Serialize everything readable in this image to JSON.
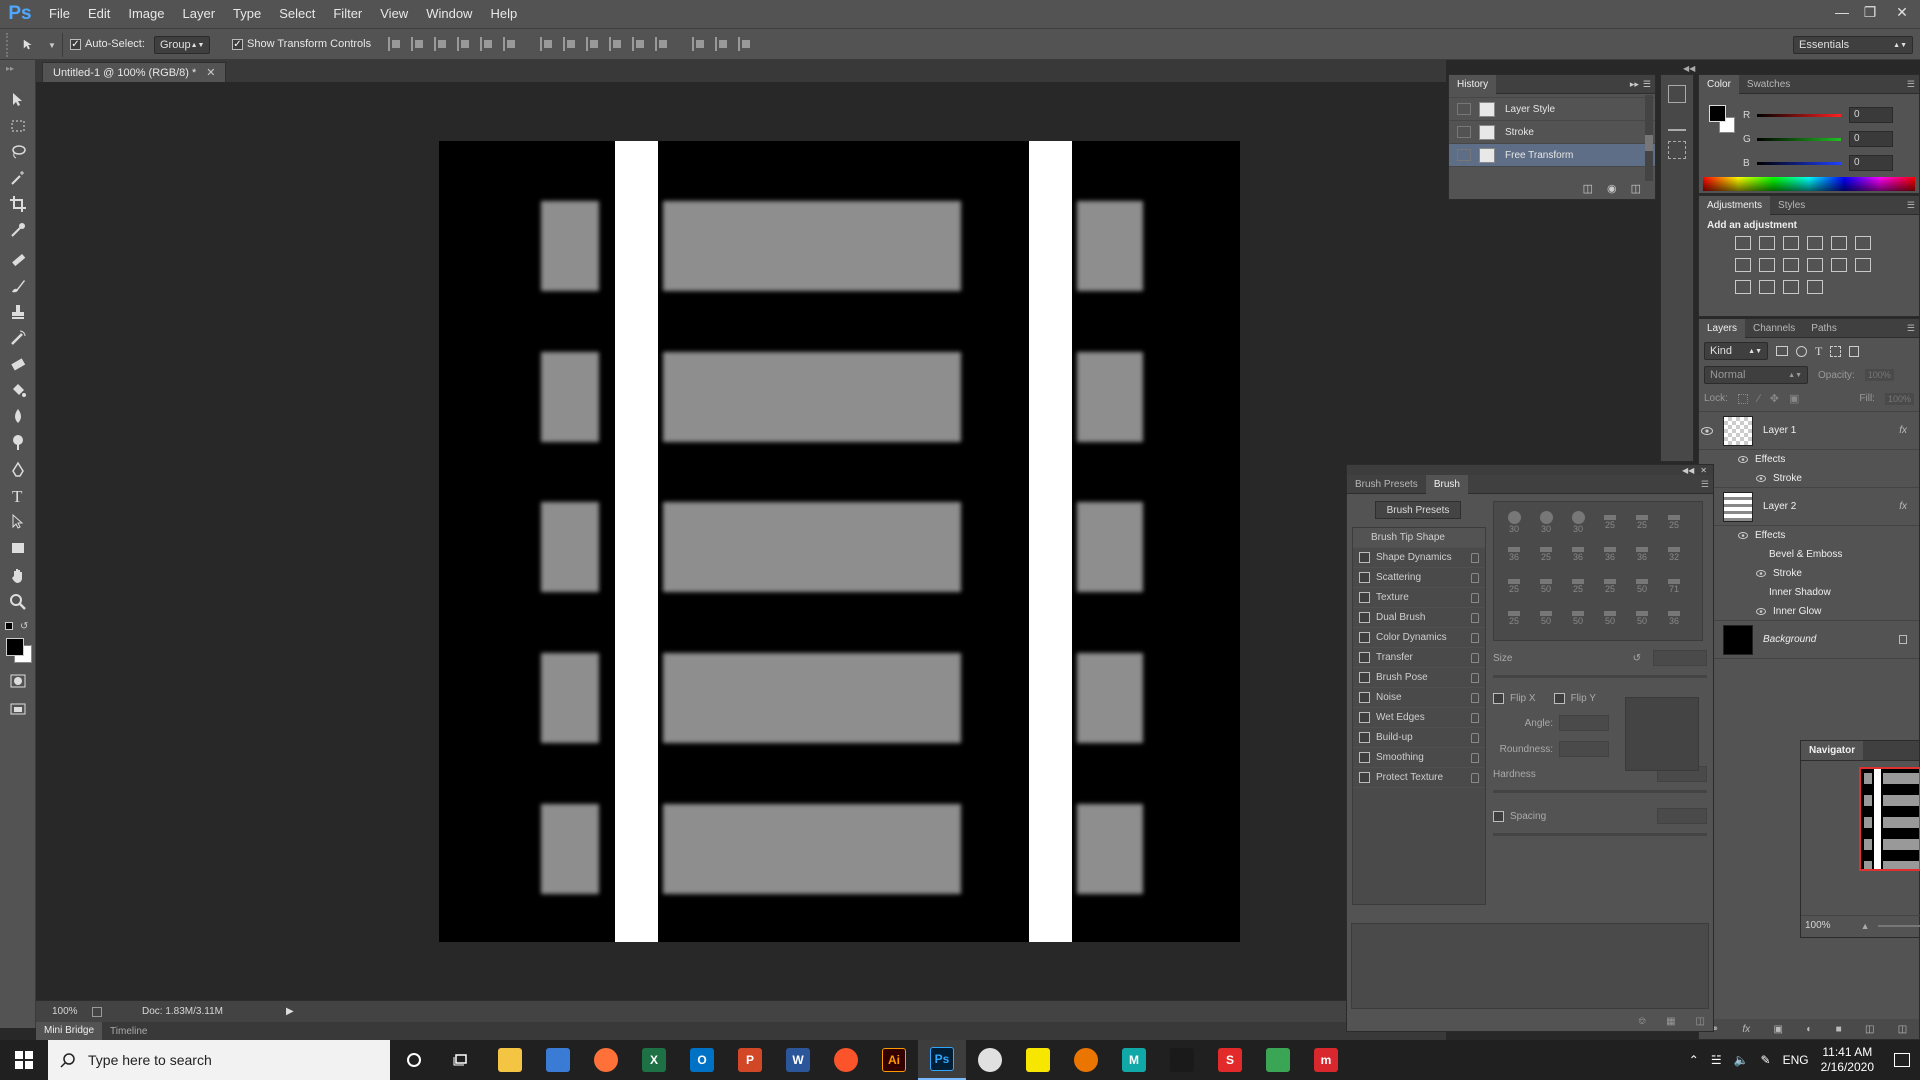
{
  "app": {
    "logo": "Ps"
  },
  "menu": [
    "File",
    "Edit",
    "Image",
    "Layer",
    "Type",
    "Select",
    "Filter",
    "View",
    "Window",
    "Help"
  ],
  "options": {
    "auto_select_label": "Auto-Select:",
    "auto_select_value": "Group",
    "transform_label": "Show Transform Controls",
    "workspace": "Essentials"
  },
  "document": {
    "tab_title": "Untitled-1 @ 100% (RGB/8) *",
    "zoom": "100%",
    "doc_info": "Doc: 1.83M/3.11M"
  },
  "bottom_tabs": [
    "Mini Bridge",
    "Timeline"
  ],
  "history": {
    "title": "History",
    "items": [
      {
        "label": "Layer Style"
      },
      {
        "label": "Stroke"
      },
      {
        "label": "Free Transform"
      }
    ]
  },
  "color_panel": {
    "tabs": [
      "Color",
      "Swatches"
    ],
    "channels": [
      {
        "name": "R",
        "value": "0",
        "color": "#ff2020"
      },
      {
        "name": "G",
        "value": "0",
        "color": "#20c020"
      },
      {
        "name": "B",
        "value": "0",
        "color": "#2040ff"
      }
    ]
  },
  "adjustments": {
    "tabs": [
      "Adjustments",
      "Styles"
    ],
    "heading": "Add an adjustment"
  },
  "layers": {
    "tabs": [
      "Layers",
      "Channels",
      "Paths"
    ],
    "kind": "Kind",
    "blend_mode": "Normal",
    "opacity_label": "Opacity:",
    "opacity_value": "100%",
    "lock_label": "Lock:",
    "fill_label": "Fill:",
    "fill_value": "100%",
    "layer1": {
      "name": "Layer 1",
      "effects": "Effects",
      "fx": [
        "Stroke"
      ]
    },
    "layer2": {
      "name": "Layer 2",
      "effects": "Effects",
      "fx": [
        "Bevel & Emboss",
        "Stroke",
        "Inner Shadow",
        "Inner Glow"
      ]
    },
    "background": {
      "name": "Background"
    }
  },
  "brush": {
    "tabs": [
      "Brush Presets",
      "Brush"
    ],
    "presets_button": "Brush Presets",
    "tip_shape": "Brush Tip Shape",
    "options": [
      "Shape Dynamics",
      "Scattering",
      "Texture",
      "Dual Brush",
      "Color Dynamics",
      "Transfer",
      "Brush Pose",
      "Noise",
      "Wet Edges",
      "Build-up",
      "Smoothing",
      "Protect Texture"
    ],
    "sizes": [
      "30",
      "30",
      "30",
      "25",
      "25",
      "25",
      "36",
      "25",
      "36",
      "36",
      "36",
      "32",
      "25",
      "50",
      "25",
      "25",
      "50",
      "71",
      "25",
      "50",
      "50",
      "50",
      "50",
      "36"
    ],
    "size_label": "Size",
    "flip_x": "Flip X",
    "flip_y": "Flip Y",
    "angle_label": "Angle:",
    "roundness_label": "Roundness:",
    "hardness_label": "Hardness",
    "spacing_label": "Spacing"
  },
  "navigator": {
    "title": "Navigator",
    "zoom": "100%"
  },
  "taskbar": {
    "search_placeholder": "Type here to search",
    "time": "11:41 AM",
    "date": "2/16/2020",
    "lang": "ENG",
    "apps": [
      {
        "name": "file-explorer",
        "color": "#f4c542",
        "glyph": ""
      },
      {
        "name": "store",
        "color": "#3a7bd5",
        "glyph": ""
      },
      {
        "name": "firefox",
        "color": "#ff7139",
        "glyph": ""
      },
      {
        "name": "excel",
        "color": "#1e7145",
        "glyph": "X"
      },
      {
        "name": "outlook",
        "color": "#0072c6",
        "glyph": "O"
      },
      {
        "name": "powerpoint",
        "color": "#d24726",
        "glyph": "P"
      },
      {
        "name": "word",
        "color": "#2b579a",
        "glyph": "W"
      },
      {
        "name": "brave",
        "color": "#fb542b",
        "glyph": ""
      },
      {
        "name": "illustrator",
        "color": "#330000",
        "glyph": "Ai"
      },
      {
        "name": "photoshop",
        "color": "#001e36",
        "glyph": "Ps"
      },
      {
        "name": "chrome",
        "color": "#e0e0e0",
        "glyph": ""
      },
      {
        "name": "sticky-notes",
        "color": "#f7e600",
        "glyph": ""
      },
      {
        "name": "blender",
        "color": "#ea7600",
        "glyph": ""
      },
      {
        "name": "maya",
        "color": "#11a8a8",
        "glyph": "M"
      },
      {
        "name": "unreal",
        "color": "#1a1a1a",
        "glyph": ""
      },
      {
        "name": "substance",
        "color": "#e22a2a",
        "glyph": "S"
      },
      {
        "name": "green-app",
        "color": "#3aa655",
        "glyph": ""
      },
      {
        "name": "mega",
        "color": "#d9272e",
        "glyph": "m"
      }
    ]
  }
}
